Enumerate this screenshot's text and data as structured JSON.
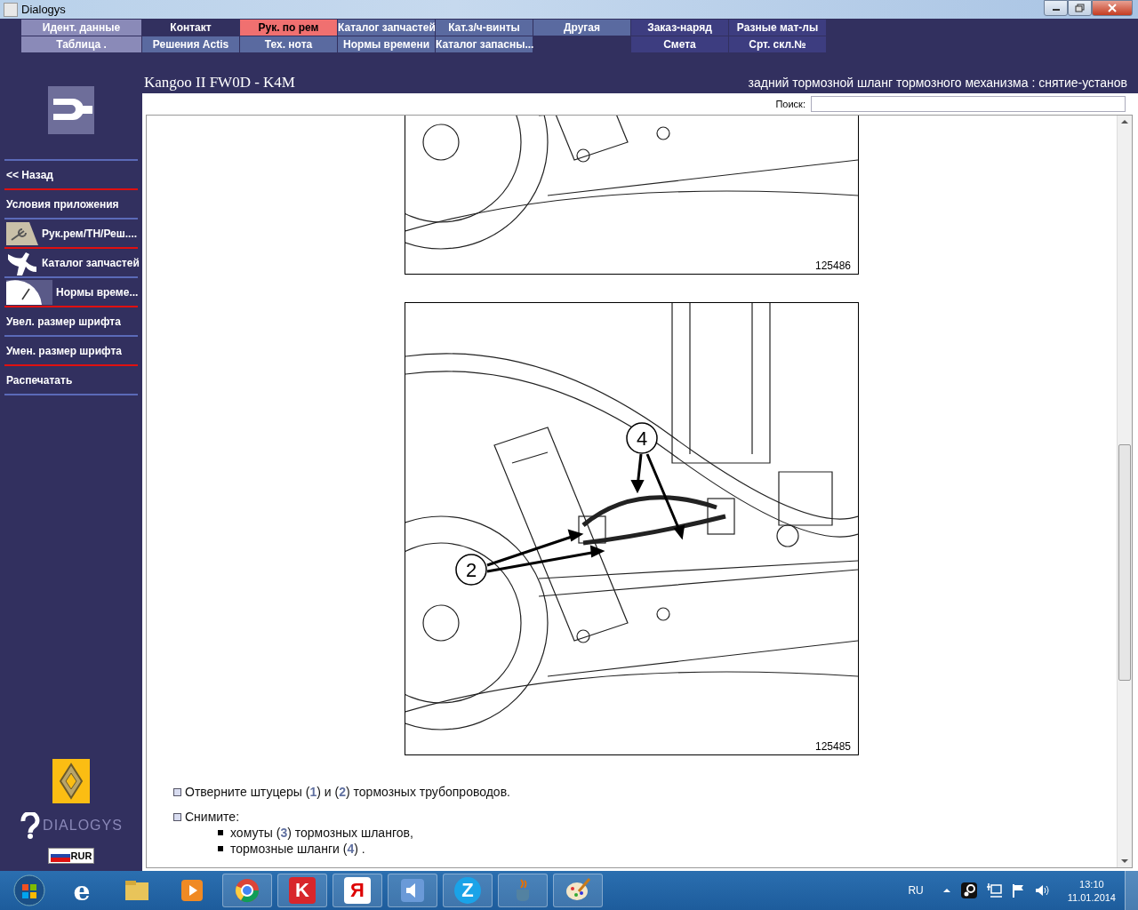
{
  "window": {
    "title": "Dialogys"
  },
  "menu": [
    {
      "items": [
        {
          "label": "Идент. данные",
          "selected": false,
          "color": "#8a8ab8"
        },
        {
          "label": "Таблица .",
          "selected": false,
          "color": "#8a8ab8"
        }
      ]
    },
    {
      "items": [
        {
          "label": "Контакт",
          "selected": false,
          "color": "#32305f"
        },
        {
          "label": "Решения Actis",
          "selected": false,
          "color": "#5a6aa0"
        }
      ]
    },
    {
      "items": [
        {
          "label": "Рук. по рем",
          "selected": true,
          "color": "#f07070"
        },
        {
          "label": "Тех. нота",
          "selected": false,
          "color": "#5a6aa0"
        }
      ]
    },
    {
      "items": [
        {
          "label": "Каталог запчастей",
          "selected": false,
          "color": "#5a6aa0"
        },
        {
          "label": "Нормы времени",
          "selected": false,
          "color": "#5a6aa0"
        }
      ]
    },
    {
      "items": [
        {
          "label": "Кат.з/ч-винты",
          "selected": false,
          "color": "#5a6aa0"
        },
        {
          "label": "Каталог запасны...",
          "selected": false,
          "color": "#5a6aa0"
        }
      ]
    },
    {
      "items": [
        {
          "label": "Другая",
          "selected": false,
          "color": "#5a6aa0"
        }
      ]
    },
    {
      "items": [
        {
          "label": "Заказ-наряд",
          "selected": false,
          "color": "#3d3d80"
        },
        {
          "label": "Смета",
          "selected": false,
          "color": "#3d3d80"
        }
      ]
    },
    {
      "items": [
        {
          "label": "Разные мат-лы",
          "selected": false,
          "color": "#3d3d80"
        },
        {
          "label": "Срт. скл.№",
          "selected": false,
          "color": "#3d3d80"
        }
      ]
    }
  ],
  "header": {
    "vehicle": "Kangoo II FW0D - K4M",
    "procedure": "задний тормозной шланг тормозного механизма : снятие-установ"
  },
  "sidebar": {
    "items": [
      {
        "label": "<< Назад",
        "kind": "plain"
      },
      {
        "label": "Условия приложения",
        "kind": "plain"
      },
      {
        "label": "Рук.рем/ТН/Реш....",
        "kind": "wrench"
      },
      {
        "label": "Каталог запчастей",
        "kind": "part"
      },
      {
        "label": "Нормы време...",
        "kind": "clock"
      },
      {
        "label": "Увел. размер шрифта",
        "kind": "plain"
      },
      {
        "label": "Умен. размер шрифта",
        "kind": "plain"
      },
      {
        "label": "Распечатать",
        "kind": "plain"
      }
    ],
    "brand": "DIALOGYS",
    "currency": "RUR"
  },
  "search": {
    "label": "Поиск:"
  },
  "figures": [
    {
      "number": "125486"
    },
    {
      "number": "125485",
      "callouts": [
        "4",
        "2"
      ]
    }
  ],
  "steps": [
    {
      "text": "Отверните штуцеры (**1**) и (**2**) тормозных трубопроводов."
    },
    {
      "text": "Снимите:",
      "bullets": [
        "хомуты (**3**) тормозных шлангов,",
        "тормозные шланги (**4**) ."
      ]
    }
  ],
  "taskbar": {
    "apps": [
      {
        "kind": "ie",
        "glyph": "e"
      },
      {
        "kind": "folder"
      },
      {
        "kind": "media"
      },
      {
        "kind": "chrome"
      },
      {
        "kind": "kaspersky",
        "glyph": "K"
      },
      {
        "kind": "yandex",
        "glyph": "Я"
      },
      {
        "kind": "speaker"
      },
      {
        "kind": "zapp",
        "glyph": "Z"
      },
      {
        "kind": "java"
      },
      {
        "kind": "paint"
      }
    ],
    "language": "RU",
    "time": "13:10",
    "date": "11.01.2014"
  }
}
